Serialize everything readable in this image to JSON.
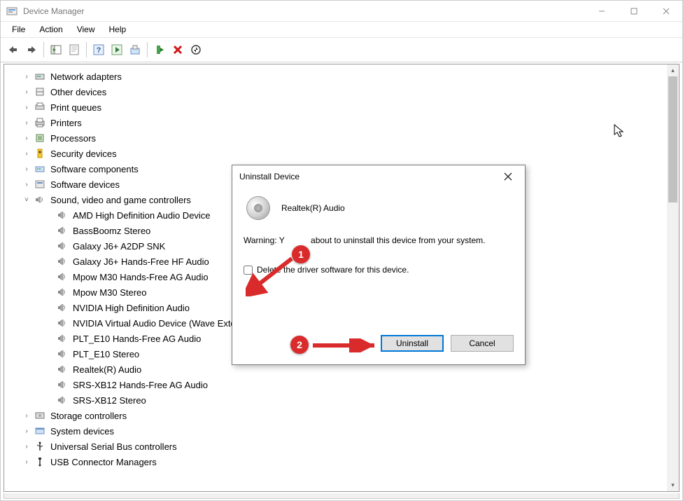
{
  "window": {
    "title": "Device Manager"
  },
  "menu": {
    "file": "File",
    "action": "Action",
    "view": "View",
    "help": "Help"
  },
  "tree": {
    "categories": [
      {
        "label": "Network adapters",
        "expanded": false,
        "icon": "network"
      },
      {
        "label": "Other devices",
        "expanded": false,
        "icon": "other"
      },
      {
        "label": "Print queues",
        "expanded": false,
        "icon": "printqueue"
      },
      {
        "label": "Printers",
        "expanded": false,
        "icon": "printer"
      },
      {
        "label": "Processors",
        "expanded": false,
        "icon": "cpu"
      },
      {
        "label": "Security devices",
        "expanded": false,
        "icon": "security"
      },
      {
        "label": "Software components",
        "expanded": false,
        "icon": "swcomp"
      },
      {
        "label": "Software devices",
        "expanded": false,
        "icon": "swdev"
      },
      {
        "label": "Sound, video and game controllers",
        "expanded": true,
        "icon": "sound",
        "children": [
          "AMD High Definition Audio Device",
          "BassBoomz Stereo",
          "Galaxy J6+ A2DP SNK",
          "Galaxy J6+ Hands-Free HF Audio",
          "Mpow M30 Hands-Free AG Audio",
          "Mpow M30 Stereo",
          "NVIDIA High Definition Audio",
          "NVIDIA Virtual Audio Device (Wave Extensible) (WDM)",
          "PLT_E10 Hands-Free AG Audio",
          "PLT_E10 Stereo",
          "Realtek(R) Audio",
          "SRS-XB12 Hands-Free AG Audio",
          "SRS-XB12 Stereo"
        ]
      },
      {
        "label": "Storage controllers",
        "expanded": false,
        "icon": "storage"
      },
      {
        "label": "System devices",
        "expanded": false,
        "icon": "system"
      },
      {
        "label": "Universal Serial Bus controllers",
        "expanded": false,
        "icon": "usb"
      },
      {
        "label": "USB Connector Managers",
        "expanded": false,
        "icon": "usbconn"
      }
    ]
  },
  "dialog": {
    "title": "Uninstall Device",
    "device": "Realtek(R) Audio",
    "warning_prefix": "Warning: Y",
    "warning_suffix": " about to uninstall this device from your system.",
    "checkbox_label": "Delete the driver software for this device.",
    "uninstall": "Uninstall",
    "cancel": "Cancel"
  },
  "annotations": {
    "one": "1",
    "two": "2"
  }
}
